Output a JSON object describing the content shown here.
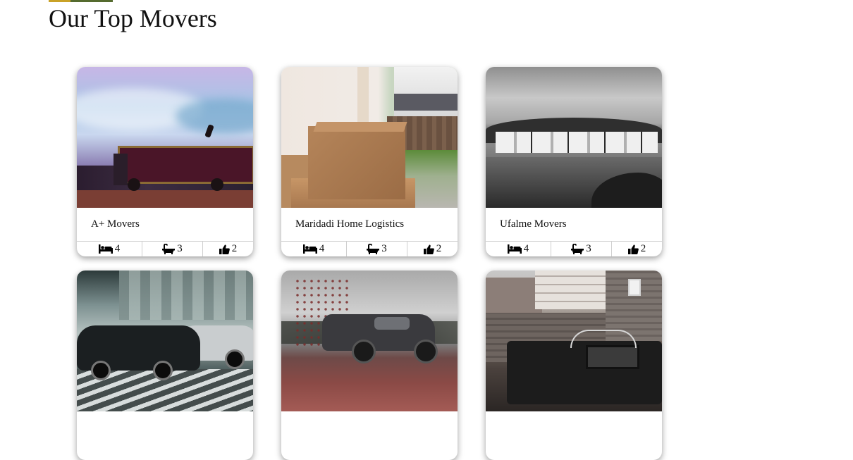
{
  "section": {
    "title": "Our Top Movers"
  },
  "colors": {
    "accent_gold": "#c9a227",
    "accent_olive": "#556b2f"
  },
  "movers": [
    {
      "name": "A+ Movers",
      "beds": "4",
      "baths": "3",
      "likes": "2",
      "image": "truck-jump-photo"
    },
    {
      "name": "Maridadi Home Logistics",
      "beds": "4",
      "baths": "3",
      "likes": "2",
      "image": "moving-boxes-photo"
    },
    {
      "name": "Ufalme Movers",
      "beds": "4",
      "baths": "3",
      "likes": "2",
      "image": "truck-fleet-photo"
    },
    {
      "name": "",
      "beds": "",
      "baths": "",
      "likes": "",
      "image": "street-cars-photo"
    },
    {
      "name": "",
      "beds": "",
      "baths": "",
      "likes": "",
      "image": "muddy-pickup-photo"
    },
    {
      "name": "",
      "beds": "",
      "baths": "",
      "likes": "",
      "image": "vintage-rover-photo"
    }
  ],
  "icons": {
    "beds": "bed-icon",
    "baths": "bathtub-icon",
    "likes": "thumbs-up-icon"
  }
}
